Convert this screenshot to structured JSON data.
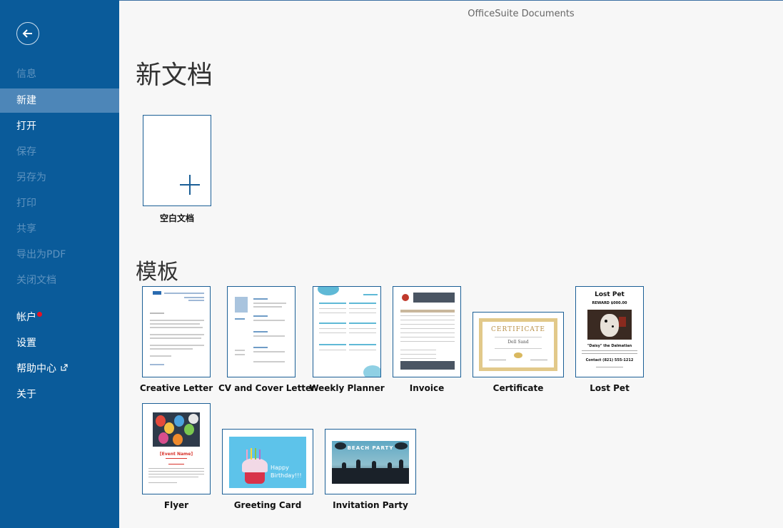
{
  "app_title": "OfficeSuite Documents",
  "sidebar": {
    "items": [
      {
        "label": "信息",
        "state": "disabled"
      },
      {
        "label": "新建",
        "state": "active"
      },
      {
        "label": "打开",
        "state": "enabled"
      },
      {
        "label": "保存",
        "state": "disabled"
      },
      {
        "label": "另存为",
        "state": "disabled"
      },
      {
        "label": "打印",
        "state": "disabled"
      },
      {
        "label": "共享",
        "state": "disabled"
      },
      {
        "label": "导出为PDF",
        "state": "disabled"
      },
      {
        "label": "关闭文档",
        "state": "disabled"
      },
      {
        "label": "帐户",
        "state": "enabled",
        "has_badge": true
      },
      {
        "label": "设置",
        "state": "enabled"
      },
      {
        "label": "帮助中心",
        "state": "enabled",
        "icon": "external-link-icon"
      },
      {
        "label": "关于",
        "state": "enabled"
      }
    ]
  },
  "main": {
    "new_doc_heading": "新文档",
    "blank_doc_label": "空白文档",
    "templates_heading": "模板",
    "templates": [
      {
        "label": "Creative Letter"
      },
      {
        "label": "CV and Cover Letter"
      },
      {
        "label": "Weekly Planner"
      },
      {
        "label": "Invoice"
      },
      {
        "label": "Certificate",
        "thumb_text": "CERTIFICATE",
        "thumb_name": "Dell Sand"
      },
      {
        "label": "Lost Pet",
        "thumb_title": "Lost Pet",
        "thumb_reward": "REWARD $000.00",
        "thumb_pet": "\"Daisy\" the Dalmatian",
        "thumb_contact": "Contact (821) 555-1212"
      },
      {
        "label": "Flyer",
        "thumb_event": "[Event Name]"
      },
      {
        "label": "Greeting Card",
        "thumb_text": "Happy Birthday!!!"
      },
      {
        "label": "Invitation Party",
        "thumb_text": "BEACH PARTY"
      }
    ]
  },
  "colors": {
    "sidebar": "#0a5b9a",
    "active": "#4d86b8",
    "accent": "#1b5f96"
  }
}
